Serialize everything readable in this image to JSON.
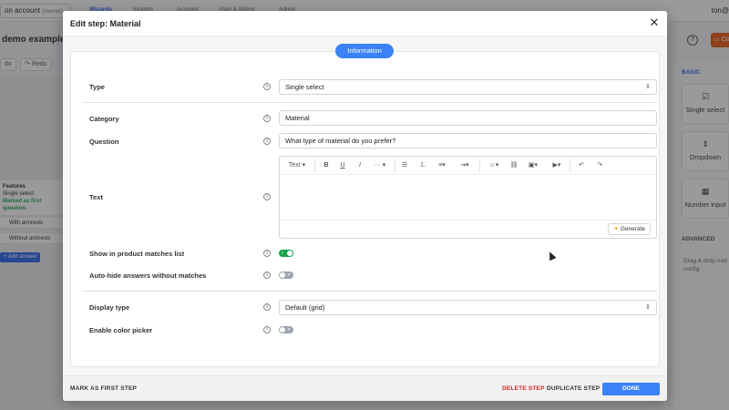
{
  "background": {
    "account_label": "on account",
    "account_role": "(owner)",
    "nav_items": [
      "Wizards",
      "Insights",
      "Account",
      "Plan & Billing",
      "Admin"
    ],
    "user_label": "ton@",
    "page_title": "demo example",
    "undo_label": "do",
    "redo_label": "Redo",
    "node": {
      "title": "Features",
      "type": "Single select",
      "note": "Marked as first question."
    },
    "answers": [
      "With armrests",
      "Without armrests"
    ],
    "add_answer_label": "Add answer",
    "orange_button_label": "Co",
    "basic_label": "BASIC",
    "cards": [
      "Single select",
      "Dropdown",
      "Number input"
    ],
    "advanced_label": "ADVANCED",
    "drag_hint": "Drag & drop nod config"
  },
  "modal": {
    "title": "Edit step: Material",
    "section_pill": "Information",
    "type": {
      "label": "Type",
      "value": "Single select"
    },
    "category": {
      "label": "Category",
      "value": "Material"
    },
    "question": {
      "label": "Question",
      "value": "What type of material do you prefer?"
    },
    "text": {
      "label": "Text",
      "toolbar": {
        "text_style": "Text",
        "more": "···"
      },
      "generate_label": "Generate"
    },
    "show_in_matches": {
      "label": "Show in product matches list",
      "enabled": true
    },
    "auto_hide": {
      "label": "Auto-hide answers without matches",
      "enabled": false
    },
    "display_type": {
      "label": "Display type",
      "value": "Default (grid)"
    },
    "color_picker": {
      "label": "Enable color picker",
      "enabled": false
    },
    "footer": {
      "mark_first": "MARK AS FIRST STEP",
      "delete": "DELETE STEP",
      "duplicate": "DUPLICATE STEP",
      "done": "DONE"
    }
  },
  "colors": {
    "accent": "#3b82f6",
    "danger": "#dc2626",
    "toggle_on": "#16a34a",
    "orange": "#ea580c"
  }
}
